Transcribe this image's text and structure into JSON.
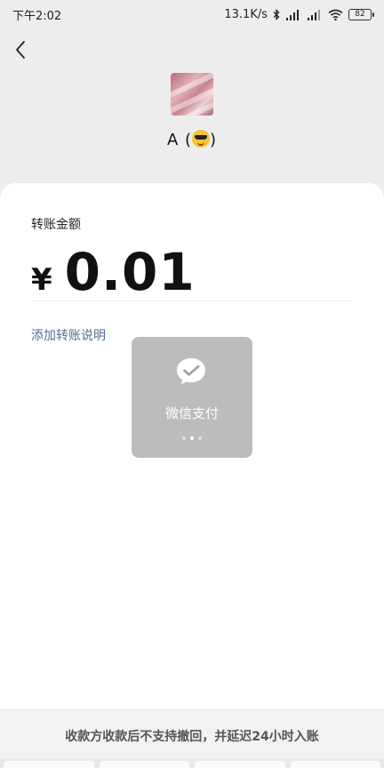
{
  "status_bar": {
    "time": "下午2:02",
    "network_speed": "13.1K/s",
    "battery_level": "82",
    "icons": [
      "bluetooth-icon",
      "hd-signal-icon",
      "signal-icon",
      "wifi-icon",
      "battery-icon"
    ]
  },
  "header": {
    "back_icon": "chevron-left-icon",
    "payee_name_prefix": "A (",
    "payee_name_emoji": "smiling-face-with-sunglasses",
    "payee_name_suffix": ")"
  },
  "transfer": {
    "amount_label": "转账金额",
    "currency_symbol": "¥",
    "amount": "0.01",
    "add_note_label": "添加转账说明"
  },
  "loading_toast": {
    "icon": "wechat-pay-icon",
    "label": "微信支付",
    "dots": 3,
    "active_dot": 2
  },
  "notice": {
    "text": "收款方收款后不支持撤回，并延迟24小时入账"
  },
  "colors": {
    "background": "#ededed",
    "card": "#ffffff",
    "link": "#576b95",
    "toast_bg": "#a5a5a5"
  }
}
